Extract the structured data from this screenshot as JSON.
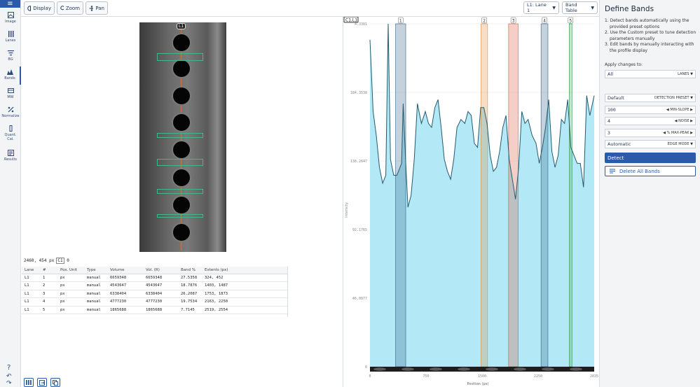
{
  "rail": {
    "menu_glyph": "≡",
    "items": [
      {
        "label": "Image",
        "icon": "image-icon"
      },
      {
        "label": "Lanes",
        "icon": "lanes-icon"
      },
      {
        "label": "BG",
        "icon": "background-icon"
      },
      {
        "label": "Bands",
        "icon": "bands-icon"
      },
      {
        "label": "MW",
        "icon": "mw-icon"
      },
      {
        "label": "Normalize",
        "icon": "percent-icon"
      },
      {
        "label": "Quant. Cal.",
        "icon": "calibration-icon"
      },
      {
        "label": "Results",
        "icon": "results-icon"
      }
    ],
    "help_glyph": "?",
    "undo_glyph": "↶",
    "redo_glyph": "↷"
  },
  "toolbar": {
    "display_label": "Display",
    "zoom_label": "Zoom",
    "pan_label": "Pan",
    "lane_select": "L1: Lane 1",
    "table_select": "Band Table"
  },
  "gel": {
    "lane_tag": "L1",
    "coord_text": "2460, 454 px",
    "coord_tag": "C1",
    "coord_val": "0"
  },
  "table": {
    "headers": [
      "Lane",
      "#",
      "Pos. Unit",
      "Type",
      "Volume",
      "Vol. (R)",
      "Band %",
      "Extents (px)"
    ],
    "rows": [
      [
        "L1",
        "1",
        "px",
        "manual",
        "6659348",
        "6659348",
        "27.5358",
        "324, 452"
      ],
      [
        "L1",
        "2",
        "px",
        "manual",
        "4543647",
        "4543647",
        "18.7876",
        "1403, 1487"
      ],
      [
        "L1",
        "3",
        "px",
        "manual",
        "6338404",
        "6338404",
        "26.2087",
        "1753, 1873"
      ],
      [
        "L1",
        "4",
        "px",
        "manual",
        "4777230",
        "4777230",
        "19.7534",
        "2163, 2250"
      ],
      [
        "L1",
        "5",
        "px",
        "manual",
        "1865688",
        "1865688",
        "7.7145",
        "2519, 2554"
      ]
    ]
  },
  "chart_data": {
    "type": "area",
    "tag": "C1,L1",
    "xlabel": "Position (px)",
    "ylabel": "Intensity",
    "xlim": [
      0,
      2835
    ],
    "ylim": [
      0,
      4.3
    ],
    "x_ticks": [
      "0",
      "750",
      "1500",
      "2250",
      "2835"
    ],
    "y_ticks": [
      "0",
      "46.0877",
      "92.1765",
      "138.2647",
      "184.3538",
      "4.3381"
    ],
    "fill_color": "#b3e9f7",
    "line_color": "#245b6c",
    "bands": [
      {
        "label": "1",
        "from": 324,
        "to": 452,
        "color": "#2f5f86"
      },
      {
        "label": "2",
        "from": 1403,
        "to": 1487,
        "color": "#e08a3e"
      },
      {
        "label": "3",
        "from": 1753,
        "to": 1873,
        "color": "#d9523b"
      },
      {
        "label": "4",
        "from": 2163,
        "to": 2250,
        "color": "#2f5f86"
      },
      {
        "label": "5",
        "from": 2519,
        "to": 2554,
        "color": "#2f9a4a"
      }
    ],
    "profile_x": [
      0,
      40,
      80,
      120,
      160,
      200,
      230,
      260,
      300,
      340,
      380,
      400,
      420,
      450,
      480,
      520,
      560,
      600,
      650,
      700,
      740,
      780,
      820,
      860,
      900,
      940,
      980,
      1020,
      1060,
      1100,
      1150,
      1200,
      1240,
      1280,
      1320,
      1360,
      1400,
      1440,
      1480,
      1520,
      1560,
      1600,
      1640,
      1680,
      1720,
      1760,
      1800,
      1840,
      1880,
      1920,
      1960,
      2000,
      2050,
      2100,
      2140,
      2180,
      2220,
      2260,
      2300,
      2340,
      2380,
      2420,
      2460,
      2500,
      2540,
      2580,
      2620,
      2660,
      2700,
      2740,
      2780,
      2835
    ],
    "profile_y": [
      4.1,
      3.2,
      2.9,
      2.5,
      2.3,
      2.4,
      4.3,
      2.6,
      2.4,
      2.4,
      2.5,
      2.55,
      3.3,
      2.6,
      2.0,
      2.15,
      2.6,
      3.3,
      3.05,
      3.2,
      3.05,
      3.0,
      3.25,
      3.35,
      3.0,
      2.6,
      2.45,
      2.35,
      2.6,
      3.0,
      3.1,
      3.05,
      3.2,
      3.15,
      2.8,
      2.75,
      3.25,
      3.25,
      3.05,
      2.65,
      2.45,
      2.5,
      2.7,
      3.0,
      3.15,
      2.6,
      2.35,
      2.1,
      2.5,
      3.2,
      3.05,
      3.1,
      2.9,
      2.8,
      2.55,
      2.75,
      3.0,
      3.35,
      2.7,
      2.5,
      2.65,
      3.1,
      3.05,
      3.35,
      2.75,
      2.65,
      2.55,
      2.55,
      2.25,
      3.4,
      3.15,
      3.4
    ]
  },
  "right_panel": {
    "title": "Define Bands",
    "steps": [
      "1. Detect bands automatically using the provided preset options",
      "2. Use the Custom preset to tune detection parameters manually",
      "3. Edit bands by manually interacting with the profile display"
    ],
    "apply_label": "Apply changes to:",
    "lanes_value": "All",
    "lanes_label": "LANES",
    "preset_value": "Default",
    "preset_label": "DETECTION PRESET",
    "min_slope_value": "100",
    "min_slope_label": "MIN-SLOPE",
    "noise_value": "4",
    "noise_label": "NOISE",
    "max_peak_value": "3",
    "max_peak_label": "% MAX-PEAK",
    "edge_value": "Automatic",
    "edge_label": "EDGE MODE",
    "detect_label": "Detect",
    "delete_label": "Delete All Bands"
  }
}
